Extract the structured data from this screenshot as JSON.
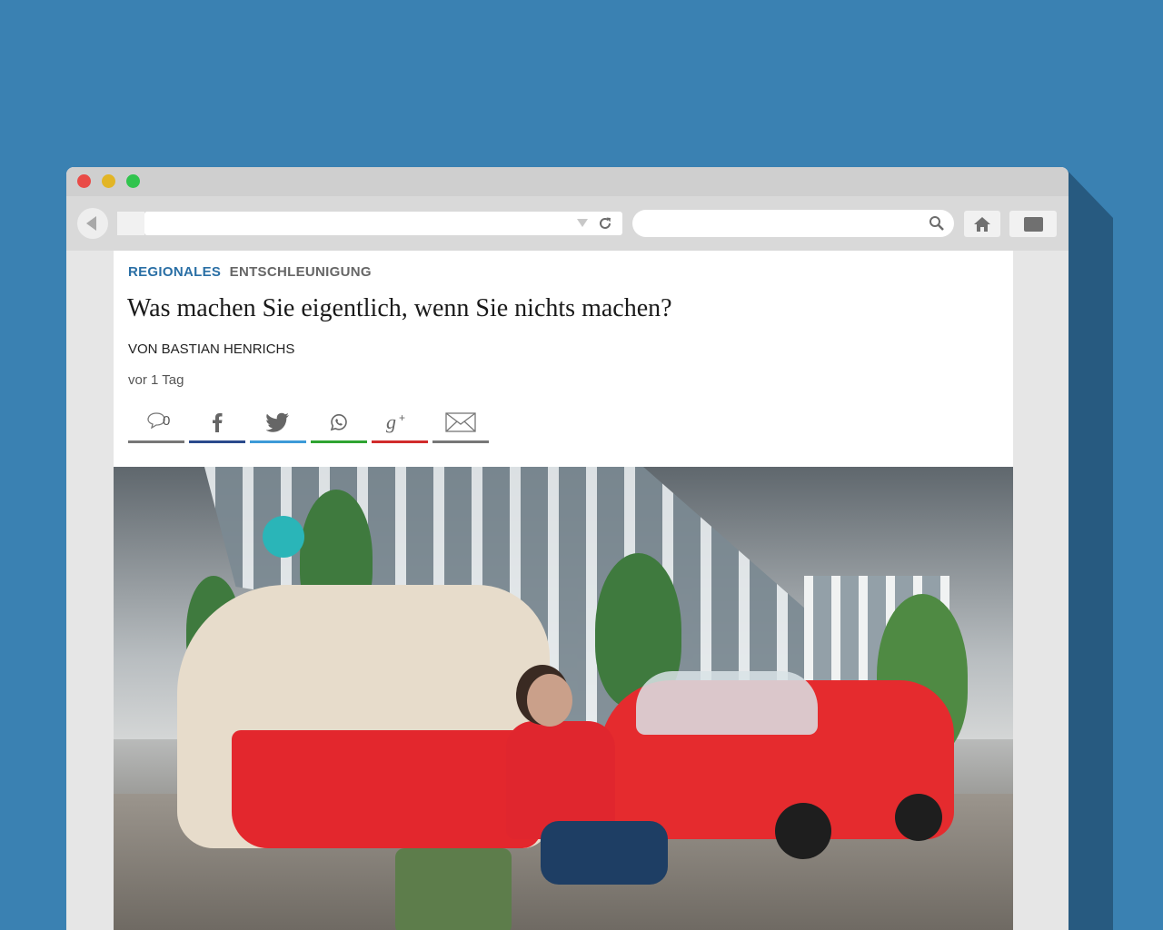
{
  "browser": {
    "url_value": "",
    "search_value": ""
  },
  "article": {
    "category": "REGIONALES",
    "subcategory": "ENTSCHLEUNIGUNG",
    "headline": "Was machen Sie eigentlich, wenn Sie nichts machen?",
    "byline": "VON BASTIAN HENRICHS",
    "date": "vor 1 Tag",
    "comment_count": "0"
  },
  "share_buttons": [
    {
      "name": "comments",
      "icon": "comment-icon",
      "color": "#777777"
    },
    {
      "name": "facebook",
      "icon": "facebook-icon",
      "color": "#2a4a8c"
    },
    {
      "name": "twitter",
      "icon": "twitter-icon",
      "color": "#3d9ad8"
    },
    {
      "name": "whatsapp",
      "icon": "whatsapp-icon",
      "color": "#2fa432"
    },
    {
      "name": "google-plus",
      "icon": "google-plus-icon",
      "color": "#d12b2b"
    },
    {
      "name": "email",
      "icon": "email-icon",
      "color": "#777777"
    }
  ],
  "colors": {
    "background": "#3a81b2",
    "category": "#2a6fa5"
  }
}
